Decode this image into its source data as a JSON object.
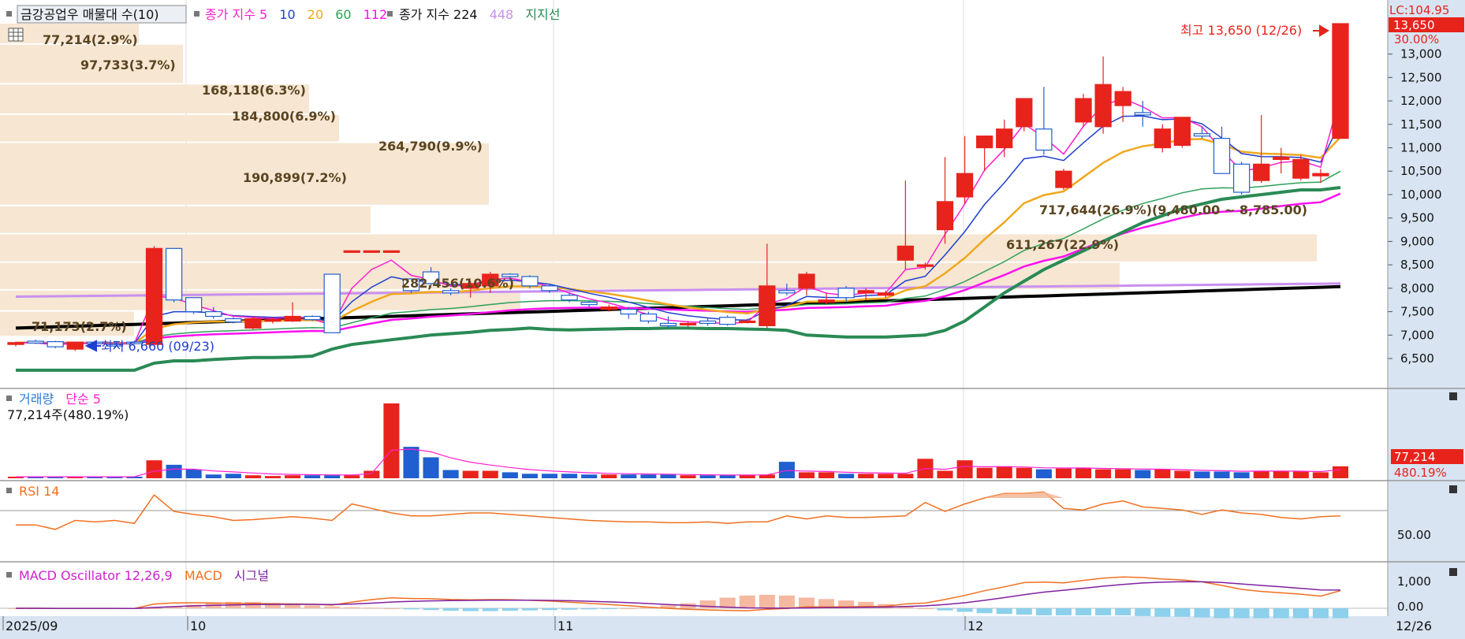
{
  "colors": {
    "up": "#e8231c",
    "down": "#1f5fcf",
    "vol_up": "#e8231c",
    "vol_down": "#1f5fcf",
    "ma5": "#ff1fd0",
    "ma10": "#1f3fcf",
    "ma20": "#f0a81e",
    "ma60": "#2ea05a",
    "ma112": "#ff10f0",
    "ma224": "#000000",
    "ma448": "#c890f0",
    "support": "#2a8a55",
    "axis_bg": "#d8e4f2",
    "band": "#f6e6d2",
    "rsi": "#f07020",
    "macd_osc": "#d020d0",
    "macd": "#f07020",
    "signal": "#8020a0",
    "hist": "#f4b9a0",
    "hist_neg": "#8cd0ec"
  },
  "header": {
    "title": "금강공업우 매물대 수(10)",
    "ma_prefix": "종가 지수 5",
    "ma10": "10",
    "ma20": "20",
    "ma60": "60",
    "ma112": "112",
    "ma224_label": "종가 지수 224",
    "ma448": "448",
    "support_label": "지지선"
  },
  "price_axis": {
    "lc_label": "LC:104.95",
    "current": "13,650",
    "pct": "30.00%",
    "ticks": [
      "13,000",
      "12,500",
      "12,000",
      "11,500",
      "11,000",
      "10,500",
      "10,000",
      "9,500",
      "9,000",
      "8,500",
      "8,000",
      "7,500",
      "7,000",
      "6,500"
    ]
  },
  "annotations": {
    "high": "최고 13,650 (12/26)",
    "low": "최저 6,660 (09/23)"
  },
  "volume_profile": [
    {
      "label": "77,214(2.9%)"
    },
    {
      "label": "97,733(3.7%)"
    },
    {
      "label": "168,118(6.3%)"
    },
    {
      "label": "184,800(6.9%)"
    },
    {
      "label": "264,790(9.9%)"
    },
    {
      "label": "190,899(7.2%)"
    },
    {
      "label": "717,644(26.9%)(9,480.00 ~ 8,785.00)"
    },
    {
      "label": "611,267(22.9%)"
    },
    {
      "label": "282,456(10.6%)"
    },
    {
      "label": "71,173(2.7%)"
    }
  ],
  "volume_panel": {
    "title": "거래량",
    "ma_label": "단순 5",
    "readout": "77,214주(480.19%)",
    "axis_value": "77,214",
    "axis_pct": "480.19%"
  },
  "rsi_panel": {
    "title": "RSI 14",
    "tick": "50.00"
  },
  "macd_panel": {
    "title": "MACD Oscillator 12,26,9",
    "macd_label": "MACD",
    "signal_label": "시그널",
    "ticks": [
      "1,000",
      "0.00"
    ]
  },
  "x_axis": {
    "labels": [
      "2025/09",
      "10",
      "11",
      "12"
    ],
    "last": "12/26"
  },
  "chart_data": {
    "type": "candlestick",
    "price_range": [
      6200,
      13900
    ],
    "candles": [
      [
        6800,
        6860,
        6760,
        6840
      ],
      [
        6870,
        6900,
        6810,
        6830
      ],
      [
        6860,
        6880,
        6720,
        6750
      ],
      [
        6700,
        6860,
        6660,
        6850
      ],
      [
        6850,
        6880,
        6780,
        6820
      ],
      [
        6800,
        6860,
        6720,
        6790
      ],
      [
        6850,
        6880,
        6800,
        6830
      ],
      [
        6800,
        8900,
        6800,
        8850
      ],
      [
        8850,
        8850,
        7700,
        7750
      ],
      [
        7800,
        7800,
        7450,
        7500
      ],
      [
        7500,
        7600,
        7350,
        7400
      ],
      [
        7350,
        7380,
        7250,
        7280
      ],
      [
        7150,
        7400,
        7120,
        7350
      ],
      [
        7300,
        7380,
        7250,
        7330
      ],
      [
        7300,
        7700,
        7280,
        7400
      ],
      [
        7400,
        7420,
        7300,
        7330
      ],
      [
        8300,
        8300,
        7050,
        7050
      ],
      [
        8800,
        8800,
        8800,
        8800
      ],
      [
        8800,
        8800,
        8800,
        8800
      ],
      [
        8800,
        8800,
        8800,
        8800
      ],
      [
        8200,
        8200,
        7900,
        7950
      ],
      [
        8350,
        8450,
        8050,
        8100
      ],
      [
        7950,
        8000,
        7850,
        7900
      ],
      [
        8000,
        8150,
        7800,
        8100
      ],
      [
        8050,
        8350,
        7900,
        8300
      ],
      [
        8300,
        8320,
        8200,
        8250
      ],
      [
        8250,
        8280,
        8000,
        8050
      ],
      [
        8050,
        8080,
        7900,
        7950
      ],
      [
        7850,
        7900,
        7700,
        7750
      ],
      [
        7700,
        7720,
        7600,
        7650
      ],
      [
        7550,
        7650,
        7500,
        7600
      ],
      [
        7550,
        7600,
        7350,
        7450
      ],
      [
        7450,
        7500,
        7250,
        7300
      ],
      [
        7250,
        7400,
        7150,
        7200
      ],
      [
        7250,
        7300,
        7180,
        7250
      ],
      [
        7300,
        7350,
        7200,
        7250
      ],
      [
        7380,
        7420,
        7200,
        7230
      ],
      [
        7300,
        7350,
        7250,
        7300
      ],
      [
        7200,
        8950,
        7150,
        8050
      ],
      [
        7950,
        8100,
        7850,
        7900
      ],
      [
        8000,
        8350,
        7850,
        8300
      ],
      [
        7700,
        7900,
        7650,
        7750
      ],
      [
        8000,
        8050,
        7700,
        7800
      ],
      [
        7900,
        8000,
        7750,
        7950
      ],
      [
        7850,
        7950,
        7800,
        7900
      ],
      [
        8600,
        10300,
        8400,
        8900
      ],
      [
        8500,
        8550,
        8400,
        8500
      ],
      [
        9250,
        10800,
        8950,
        9850
      ],
      [
        9950,
        11250,
        9800,
        10450
      ],
      [
        11000,
        11250,
        10500,
        11250
      ],
      [
        11000,
        11600,
        10800,
        11400
      ],
      [
        11450,
        12050,
        11350,
        12050
      ],
      [
        11400,
        12300,
        10850,
        10950
      ],
      [
        10150,
        10550,
        10100,
        10500
      ],
      [
        11550,
        12150,
        11450,
        12050
      ],
      [
        11450,
        12950,
        11300,
        12350
      ],
      [
        11900,
        12300,
        11550,
        12200
      ],
      [
        11750,
        12000,
        11450,
        11700
      ],
      [
        11000,
        11500,
        10900,
        11400
      ],
      [
        11050,
        11550,
        11000,
        11650
      ],
      [
        11300,
        11450,
        11200,
        11250
      ],
      [
        11200,
        11450,
        10750,
        10450
      ],
      [
        10650,
        10700,
        10000,
        10050
      ],
      [
        10300,
        11700,
        10250,
        10650
      ],
      [
        10750,
        11000,
        10450,
        10800
      ],
      [
        10350,
        10850,
        10300,
        10750
      ],
      [
        10400,
        10550,
        10250,
        10450
      ],
      [
        11200,
        13650,
        11200,
        13650
      ]
    ],
    "volume": [
      2,
      2,
      2,
      2,
      2,
      2,
      2,
      24,
      18,
      12,
      5,
      6,
      4,
      3,
      4,
      4,
      4,
      4,
      10,
      100,
      42,
      28,
      11,
      10,
      10,
      8,
      6,
      6,
      6,
      5,
      5,
      5,
      5,
      5,
      4,
      4,
      4,
      4,
      5,
      22,
      8,
      8,
      6,
      6,
      6,
      6,
      26,
      10,
      24,
      14,
      16,
      14,
      12,
      13,
      14,
      12,
      12,
      11,
      12,
      10,
      9,
      9,
      8,
      10,
      10,
      9,
      8,
      16
    ],
    "rsi": [
      44,
      44,
      38,
      50,
      48,
      50,
      46,
      84,
      62,
      58,
      55,
      50,
      51,
      53,
      55,
      53,
      50,
      72,
      66,
      60,
      56,
      56,
      58,
      60,
      60,
      58,
      56,
      54,
      52,
      50,
      49,
      48,
      48,
      47,
      47,
      48,
      46,
      48,
      48,
      56,
      52,
      56,
      54,
      54,
      55,
      56,
      74,
      62,
      72,
      80,
      86,
      86,
      88,
      66,
      64,
      72,
      76,
      68,
      66,
      64,
      58,
      64,
      60,
      58,
      54,
      52,
      55,
      56,
      75
    ],
    "macd_hist": [
      0,
      0,
      0,
      0,
      0,
      0,
      0,
      0,
      5,
      10,
      15,
      18,
      18,
      15,
      10,
      8,
      5,
      3,
      2,
      0,
      -3,
      -5,
      -7,
      -8,
      -8,
      -7,
      -6,
      -5,
      -4,
      -3,
      -2,
      0,
      3,
      8,
      14,
      22,
      30,
      36,
      38,
      36,
      30,
      26,
      22,
      18,
      12,
      6,
      0,
      -6,
      -10,
      -14,
      -16,
      -18,
      -20,
      -20,
      -20,
      -20,
      -20,
      -22,
      -24,
      -24,
      -26,
      -28,
      -28,
      -28,
      -28,
      -28,
      -28,
      -28,
      -28
    ]
  }
}
